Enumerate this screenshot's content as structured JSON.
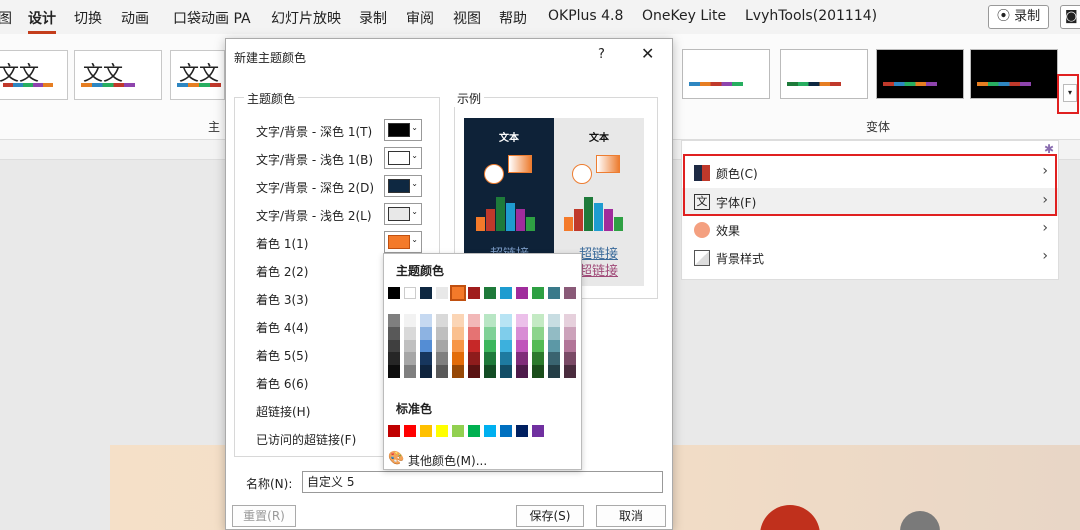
{
  "tabs": [
    "图",
    "设计",
    "切换",
    "动画",
    "口袋动画 PA",
    "幻灯片放映",
    "录制",
    "审阅",
    "视图",
    "帮助",
    "OKPlus 4.8",
    "OneKey Lite",
    "LvyhTools(201114)"
  ],
  "active_tab": "设计",
  "record_button": "⦿ 录制",
  "ribbon": {
    "theme_text": "文文",
    "theme_text_single": "文文",
    "group_theme_label": "主",
    "group_variant_label": "变体",
    "dropdown_icon": "▾"
  },
  "variant_menu": {
    "items": [
      {
        "label": "颜色(C)",
        "icon": "palette-squares-icon"
      },
      {
        "label": "字体(F)",
        "icon": "font-wen-icon"
      },
      {
        "label": "效果",
        "icon": "effects-circle-icon"
      },
      {
        "label": "背景样式",
        "icon": "background-style-icon"
      }
    ],
    "chevron": "›"
  },
  "dialog": {
    "title": "新建主题颜色",
    "help": "?",
    "close": "✕",
    "group_theme": "主题颜色",
    "group_example": "示例",
    "rows": [
      {
        "label": "文字/背景 - 深色 1(T)",
        "color": "#000000"
      },
      {
        "label": "文字/背景 - 浅色 1(B)",
        "color": "#ffffff"
      },
      {
        "label": "文字/背景 - 深色 2(D)",
        "color": "#0e2841"
      },
      {
        "label": "文字/背景 - 浅色 2(L)",
        "color": "#e8e8e8"
      },
      {
        "label": "着色 1(1)",
        "color": "#f47a2a"
      },
      {
        "label": "着色 2(2)"
      },
      {
        "label": "着色 3(3)"
      },
      {
        "label": "着色 4(4)"
      },
      {
        "label": "着色 5(5)"
      },
      {
        "label": "着色 6(6)"
      },
      {
        "label": "超链接(H)"
      },
      {
        "label": "已访问的超链接(F)"
      }
    ],
    "preview": {
      "text_dark": "文本",
      "text_light": "文本",
      "hyperlink": "超链接",
      "visited": "超链接"
    },
    "name_label": "名称(N):",
    "name_value": "自定义 5",
    "reset": "重置(R)",
    "save": "保存(S)",
    "cancel": "取消"
  },
  "palette": {
    "theme_header": "主题颜色",
    "standard_header": "标准色",
    "more": "其他颜色(M)...",
    "theme_row": [
      "#000000",
      "#ffffff",
      "#0e2841",
      "#e8e8e8",
      "#f47a2a",
      "#a01c1c",
      "#1e7a3a",
      "#1e9cd0",
      "#a02c9c",
      "#2ea043",
      "#3a7a8a",
      "#8a5a78"
    ],
    "standard": [
      "#c00000",
      "#ff0000",
      "#ffc000",
      "#ffff00",
      "#92d050",
      "#00b050",
      "#00b0f0",
      "#0070c0",
      "#002060",
      "#7030a0"
    ],
    "shade_columns": [
      [
        "#7f7f7f",
        "#595959",
        "#3f3f3f",
        "#262626",
        "#0d0d0d"
      ],
      [
        "#f2f2f2",
        "#d9d9d9",
        "#bfbfbf",
        "#a6a6a6",
        "#7f7f7f"
      ],
      [
        "#c6d9f1",
        "#8db3e2",
        "#548dd4",
        "#17365d",
        "#0f243e"
      ],
      [
        "#d9d9d9",
        "#bfbfbf",
        "#a6a6a6",
        "#7f7f7f",
        "#595959"
      ],
      [
        "#fbd5b5",
        "#fac08f",
        "#f79646",
        "#e36c09",
        "#974806"
      ],
      [
        "#f2b8b8",
        "#e57373",
        "#c62828",
        "#8e1c1c",
        "#5a1212"
      ],
      [
        "#b8e6c4",
        "#7fd196",
        "#3cb65c",
        "#1e7a3a",
        "#124d24"
      ],
      [
        "#b8e4f4",
        "#7fcdeb",
        "#3cb0dd",
        "#1e7aa0",
        "#124d66"
      ],
      [
        "#ecc0ea",
        "#d88cd4",
        "#c054bb",
        "#802c7a",
        "#4d1a4a"
      ],
      [
        "#c4eac4",
        "#8cd48c",
        "#54bb54",
        "#2c7a2c",
        "#1a4d1a"
      ],
      [
        "#c8dde2",
        "#92bbc4",
        "#5c98a6",
        "#3a6470",
        "#243e46"
      ],
      [
        "#e6d0dc",
        "#cca2ba",
        "#b27598",
        "#7a4a66",
        "#4a2c3e"
      ]
    ]
  },
  "colors": {
    "accent_red": "#c43e1c",
    "highlight_box": "#e02020"
  }
}
